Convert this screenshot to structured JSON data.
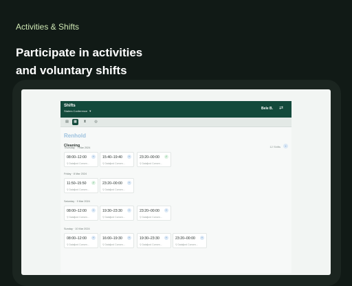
{
  "promo": {
    "eyebrow": "Activities & Shifts",
    "headline_line1": "Participate in activities",
    "headline_line2": "and voluntary shifts"
  },
  "colors": {
    "header": "#134a3b",
    "accent": "#cfe8b4",
    "link": "#9cc1de",
    "check": "#2f9b55"
  },
  "app": {
    "title": "Shifts",
    "subtitle": "Stalers Conference",
    "user": "Bele B.",
    "toolbar": [
      "list-view-icon",
      "grid-view-icon",
      "hourglass-icon",
      "settings-icon"
    ]
  },
  "section": {
    "title": "Renhold",
    "category": "Cleaning",
    "count": "12 Shifts",
    "count_icon": "+"
  },
  "days": [
    {
      "label": "Thursday · 7 Mar 2024",
      "shifts": [
        {
          "time": "08:00–12:00",
          "status": "+",
          "location": "Datafjord Conven..."
        },
        {
          "time": "15:40–19:40",
          "status": "+",
          "location": "Datafjord Conven..."
        },
        {
          "time": "23:20–00:00",
          "status": "✓",
          "location": "Datafjord Conven..."
        }
      ]
    },
    {
      "label": "Friday · 8 Mar 2024",
      "shifts": [
        {
          "time": "11:50–15:50",
          "status": "✓",
          "location": "Datafjord Conven..."
        },
        {
          "time": "23:20–00:00",
          "status": "+",
          "location": "Datafjord Conven..."
        }
      ]
    },
    {
      "label": "Saturday · 9 Mar 2024",
      "shifts": [
        {
          "time": "08:00–12:00",
          "status": "+",
          "location": "Datafjord Conven..."
        },
        {
          "time": "19:30–23:30",
          "status": "+",
          "location": "Datafjord Conven..."
        },
        {
          "time": "23:20–00:00",
          "status": "+",
          "location": "Datafjord Conven..."
        }
      ]
    },
    {
      "label": "Sunday · 10 Mar 2024",
      "shifts": [
        {
          "time": "08:00–12:00",
          "status": "+",
          "location": "Datafjord Conven..."
        },
        {
          "time": "16:00–19:30",
          "status": "+",
          "location": "Datafjord Conven..."
        },
        {
          "time": "19:30–23:30",
          "status": "+",
          "location": "Datafjord Conven..."
        },
        {
          "time": "23:20–00:00",
          "status": "+",
          "location": "Datafjord Conven..."
        }
      ]
    }
  ]
}
